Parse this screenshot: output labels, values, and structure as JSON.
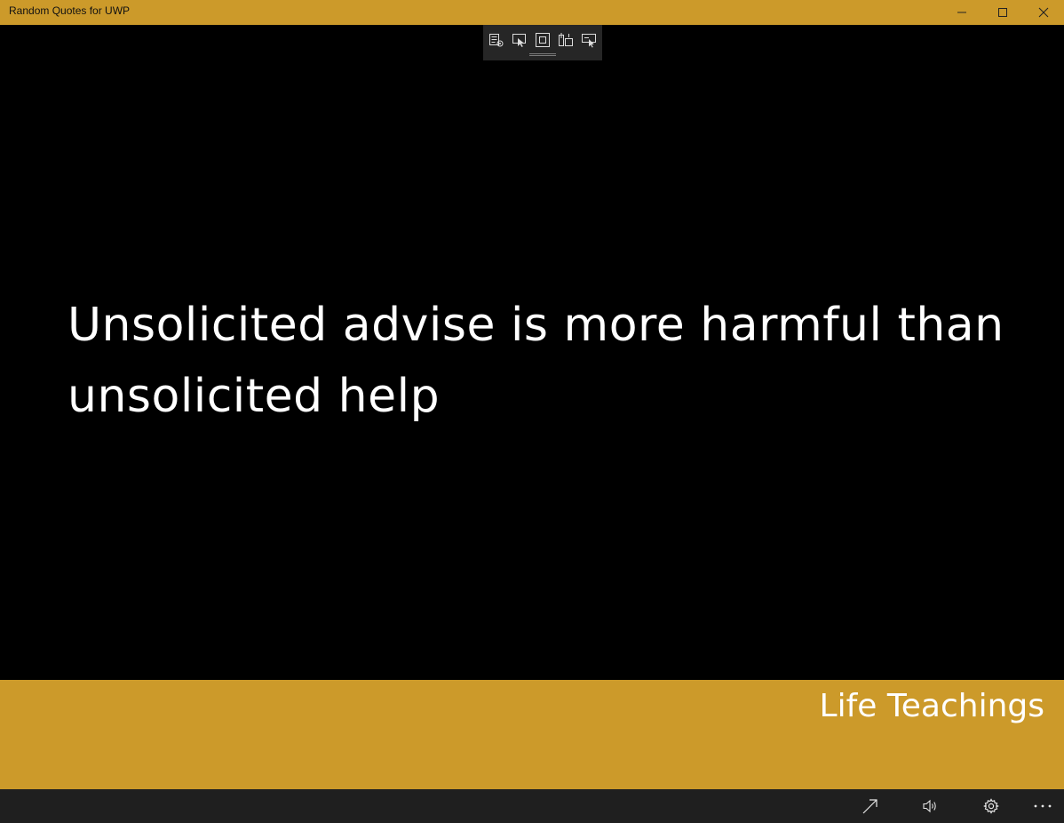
{
  "window": {
    "title": "Random Quotes for UWP",
    "accent_color": "#cc9a2a",
    "controls": [
      "minimize-icon",
      "maximize-icon",
      "close-icon"
    ]
  },
  "debug_toolbar": {
    "icons": [
      "live-visual-tree-icon",
      "select-element-icon",
      "display-layout-adorners-icon",
      "track-focus-icon",
      "display-layout-icon"
    ]
  },
  "quote": {
    "text": "Unsolicited advise is more harmful than unsolicited help"
  },
  "category": {
    "label": "Life Teachings"
  },
  "command_bar": {
    "icons": [
      "share-icon",
      "speaker-icon",
      "gear-icon",
      "more-icon"
    ]
  }
}
